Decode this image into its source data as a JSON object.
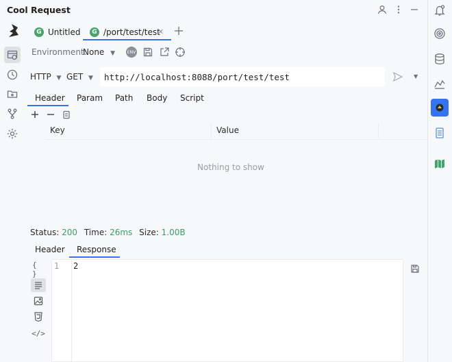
{
  "app": {
    "title": "Cool Request"
  },
  "tabs": [
    {
      "label": "Untitled",
      "badge": "G"
    },
    {
      "label": "/port/test/test",
      "badge": "G"
    }
  ],
  "environment": {
    "label": "Environment:",
    "value": "None"
  },
  "request": {
    "protocol": "HTTP",
    "method": "GET",
    "url": "http://localhost:8088/port/test/test"
  },
  "request_tabs": [
    "Header",
    "Param",
    "Path",
    "Body",
    "Script"
  ],
  "table": {
    "columns": [
      "Key",
      "Value"
    ],
    "empty_text": "Nothing to show"
  },
  "status": {
    "status_label": "Status:",
    "status_value": "200",
    "time_label": "Time:",
    "time_value": "26ms",
    "size_label": "Size:",
    "size_value": "1.00B"
  },
  "response_tabs": [
    "Header",
    "Response"
  ],
  "response": {
    "lines": [
      {
        "number": "1",
        "content": "2"
      }
    ]
  },
  "colors": {
    "accent": "#3574f0",
    "status_green": "#3b9a6b",
    "badge_green": "#4aa36f"
  },
  "icons": {
    "title_bar": [
      "person-icon",
      "more-vertical-icon",
      "minimize-icon"
    ],
    "left_strip": [
      "request-icon",
      "clock-icon",
      "folder-icon",
      "fork-icon",
      "gear-icon"
    ],
    "right_strip": [
      "notification-bell-icon",
      "spiral-icon",
      "database-icon",
      "ai-icon",
      "cool-request-plugin-icon",
      "calculator-icon",
      "map-icon"
    ],
    "response_view": [
      "braces-icon",
      "text-icon",
      "image-icon",
      "html5-icon",
      "code-icon"
    ]
  }
}
